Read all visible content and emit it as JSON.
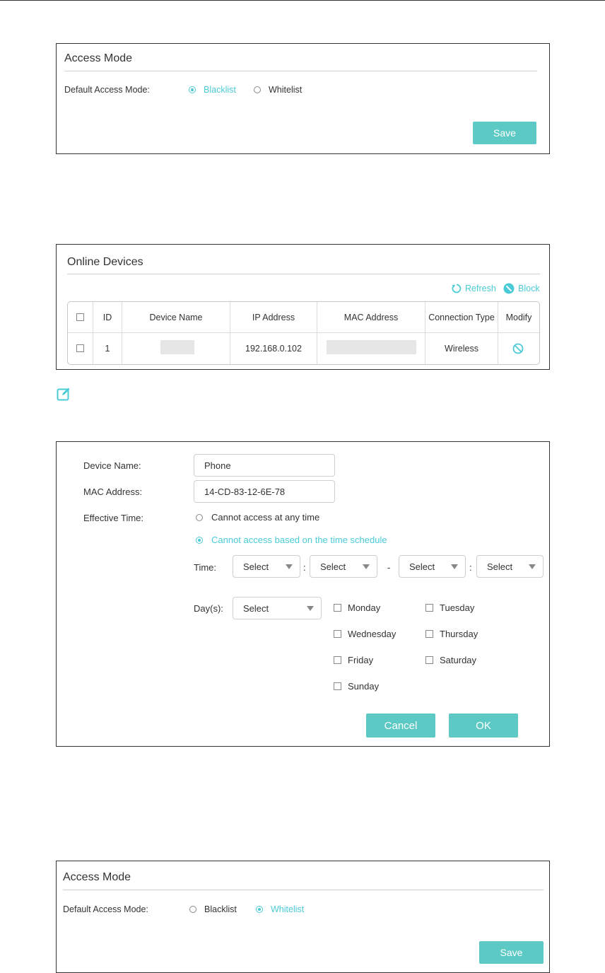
{
  "access_mode_1": {
    "title": "Access Mode",
    "label": "Default Access Mode:",
    "options": [
      {
        "label": "Blacklist",
        "selected": true
      },
      {
        "label": "Whitelist",
        "selected": false
      }
    ],
    "save_label": "Save"
  },
  "online_devices": {
    "title": "Online Devices",
    "refresh_label": "Refresh",
    "block_label": "Block",
    "columns": [
      "ID",
      "Device Name",
      "IP Address",
      "MAC Address",
      "Connection Type",
      "Modify"
    ],
    "rows": [
      {
        "id": "1",
        "device_name": "",
        "ip": "192.168.0.102",
        "mac": "",
        "connection": "Wireless"
      }
    ]
  },
  "edit_form": {
    "device_name_label": "Device Name:",
    "device_name_value": "Phone",
    "mac_label": "MAC Address:",
    "mac_value": "14-CD-83-12-6E-78",
    "effective_label": "Effective Time:",
    "opt_any": "Cannot access at any time",
    "opt_schedule": "Cannot access based on the time schedule",
    "time_label": "Time:",
    "select_placeholder": "Select",
    "colon": ":",
    "dash": "-",
    "days_label": "Day(s):",
    "days": [
      "Monday",
      "Tuesday",
      "Wednesday",
      "Thursday",
      "Friday",
      "Saturday",
      "Sunday"
    ],
    "cancel_label": "Cancel",
    "ok_label": "OK"
  },
  "access_mode_2": {
    "title": "Access Mode",
    "label": "Default Access Mode:",
    "options": [
      {
        "label": "Blacklist",
        "selected": false
      },
      {
        "label": "Whitelist",
        "selected": true
      }
    ],
    "save_label": "Save"
  },
  "colors": {
    "accent": "#4acbd6",
    "button": "#5cc9c5"
  }
}
